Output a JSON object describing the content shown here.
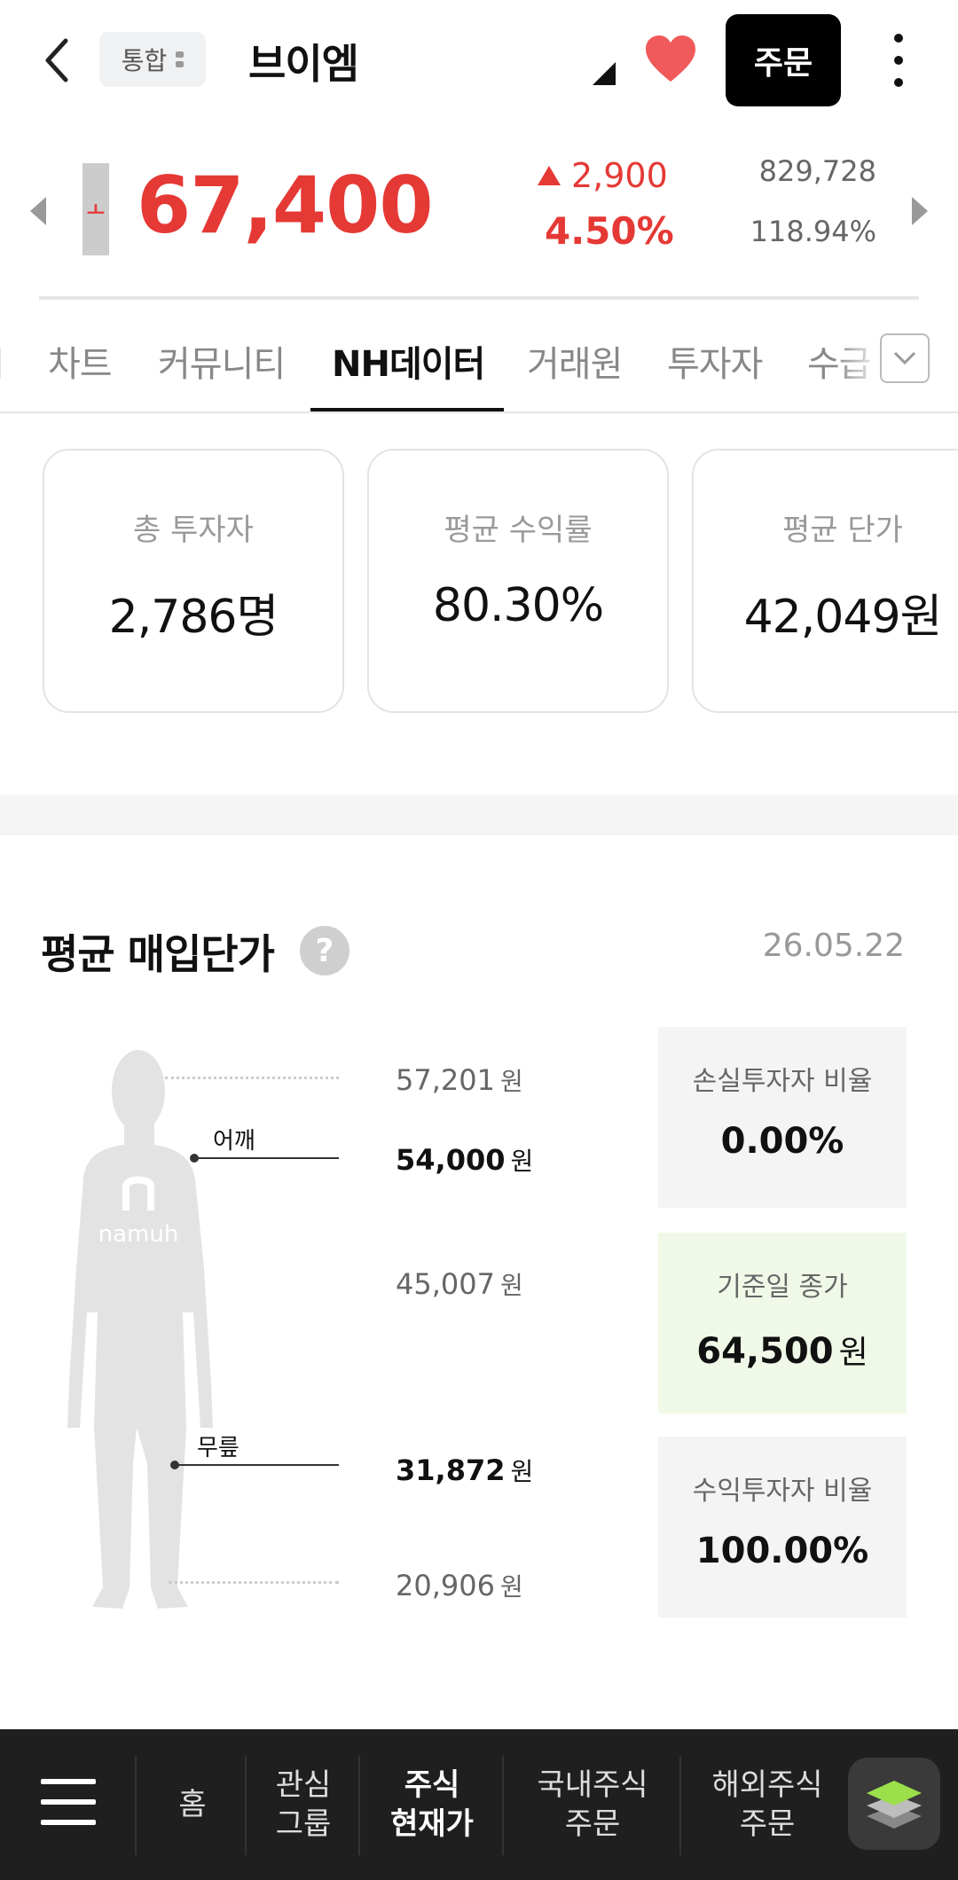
{
  "header": {
    "combo_label": "통합",
    "stock_name": "브이엠",
    "order_label": "주문"
  },
  "quote": {
    "limit_marker": "ㅗ",
    "price": "67,400",
    "change_amount": "2,900",
    "change_rate": "4.50%",
    "volume": "829,728",
    "volume_rate": "118.94%",
    "accent_color": "#e53935"
  },
  "tabs": [
    {
      "label": "차트"
    },
    {
      "label": "커뮤니티"
    },
    {
      "label": "NH데이터",
      "active": true
    },
    {
      "label": "거래원"
    },
    {
      "label": "투자자"
    },
    {
      "label": "수급"
    }
  ],
  "summary": [
    {
      "label": "총 투자자",
      "value": "2,786명"
    },
    {
      "label": "평균 수익률",
      "value": "80.30%"
    },
    {
      "label": "평균 단가",
      "value": "42,049원"
    }
  ],
  "avg_price": {
    "title": "평균 매입단가",
    "date": "26.05.22",
    "figure_brand": "namuh",
    "shoulder_label": "어깨",
    "knee_label": "무릎",
    "unit": "원",
    "levels": [
      "57,201",
      "54,000",
      "45,007",
      "31,872",
      "20,906"
    ],
    "loss_ratio_label": "손실투자자 비율",
    "loss_ratio": "0.00%",
    "close_label": "기준일 종가",
    "close_price": "64,500",
    "profit_ratio_label": "수익투자자 비율",
    "profit_ratio": "100.00%",
    "highlight_color": "#f0f9e8"
  },
  "bottom_nav": {
    "home": "홈",
    "watch_1": "관심",
    "watch_2": "그룹",
    "quote_1": "주식",
    "quote_2": "현재가",
    "domestic_1": "국내주식",
    "domestic_2": "주문",
    "overseas_1": "해외주식",
    "overseas_2": "주문"
  }
}
